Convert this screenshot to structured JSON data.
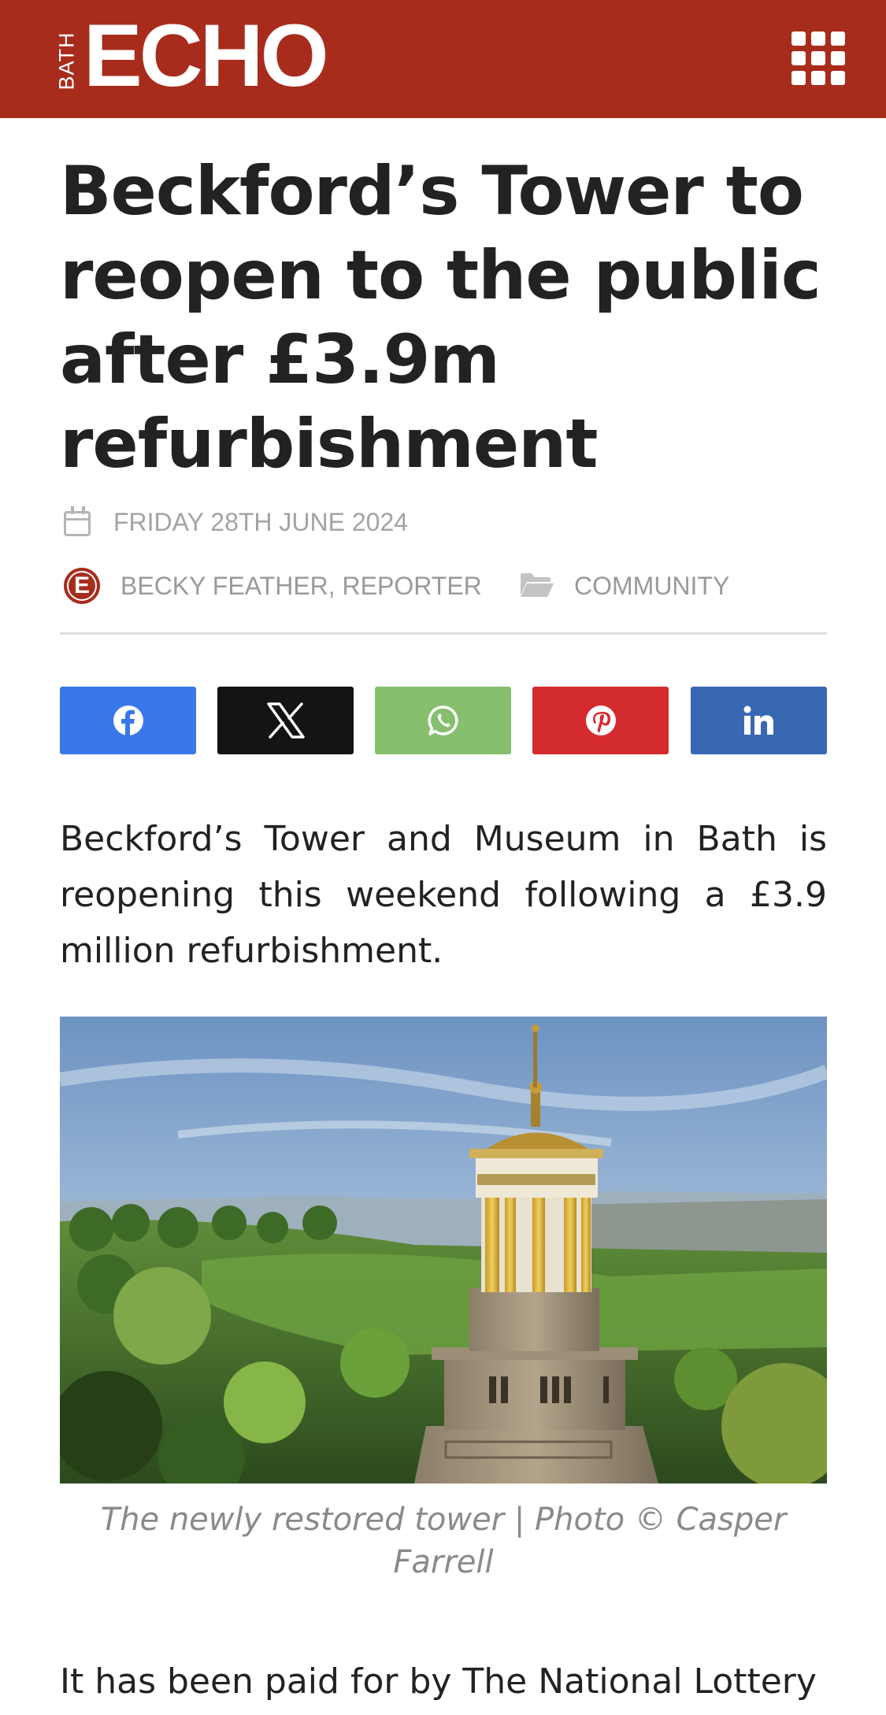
{
  "header": {
    "logo_small": "BATH",
    "logo_big": "ECHO",
    "menu_icon": "grid-menu-icon",
    "background_color": "#a82c1c"
  },
  "article": {
    "title": "Beckford’s Tower to reopen to the public after £3.9m refurbishment",
    "date": "FRIDAY 28TH JUNE 2024",
    "author_initial": "E",
    "author": "BECKY FEATHER, REPORTER",
    "category": "COMMUNITY",
    "paragraph_1": "Beckford’s Tower and Museum in Bath is reopening this weekend following a £3.9 million refurbishment.",
    "image_caption": "The newly restored tower | Photo © Casper Farrell",
    "paragraph_2": "It has been paid for by The National Lottery"
  },
  "share": [
    {
      "network": "facebook",
      "icon": "facebook-icon",
      "color": "#3a78ea"
    },
    {
      "network": "x",
      "icon": "x-icon",
      "color": "#141414"
    },
    {
      "network": "whatsapp",
      "icon": "whatsapp-icon",
      "color": "#86c06f"
    },
    {
      "network": "pinterest",
      "icon": "pinterest-icon",
      "color": "#d42b2f"
    },
    {
      "network": "linkedin",
      "icon": "linkedin-icon",
      "color": "#3968b3"
    }
  ]
}
